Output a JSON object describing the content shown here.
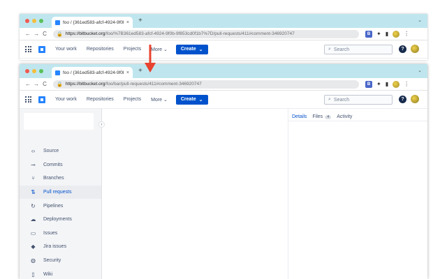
{
  "browser": {
    "tab_title": "foo / {361ed583-afcf-4924-9f0b-9f853cd0f1b7}",
    "tab_close": "×",
    "new_tab": "+",
    "strip_menu": "⌄",
    "nav_back": "←",
    "nav_forward": "→",
    "nav_reload": "C",
    "ext_b_label": "B",
    "menu_dots": "⋮"
  },
  "back_window": {
    "url_host": "https://bitbucket.org",
    "url_rest": "/foo/%7B361ed583-afcf-4924-9f0b-9f853cd0f1b7%7D/pull-requests/411#comment-346920747"
  },
  "front_window": {
    "url_host": "https://bitbucket.org",
    "url_rest": "/foo/bar/pull-requests/411#comment-346920747"
  },
  "bitbucket_nav": {
    "your_work": "Your work",
    "repositories": "Repositories",
    "projects": "Projects",
    "more": "More",
    "create": "Create",
    "search_placeholder": "Search",
    "help": "?"
  },
  "sidebar": {
    "items": [
      {
        "label": "Source",
        "icon": "‹›"
      },
      {
        "label": "Commits",
        "icon": "⊸"
      },
      {
        "label": "Branches",
        "icon": "⑂"
      },
      {
        "label": "Pull requests",
        "icon": "⇅"
      },
      {
        "label": "Pipelines",
        "icon": "↻"
      },
      {
        "label": "Deployments",
        "icon": "☁"
      },
      {
        "label": "Issues",
        "icon": "▭"
      },
      {
        "label": "Jira issues",
        "icon": "◆"
      },
      {
        "label": "Security",
        "icon": "◍"
      },
      {
        "label": "Wiki",
        "icon": "▯"
      }
    ],
    "collapse": "‹"
  },
  "details_panel": {
    "tab_details": "Details",
    "tab_files": "Files",
    "files_count": "4",
    "tab_activity": "Activity"
  },
  "colors": {
    "tabstrip": "#bfe6ee",
    "accent": "#0052cc",
    "arrow": "#e8432f"
  }
}
